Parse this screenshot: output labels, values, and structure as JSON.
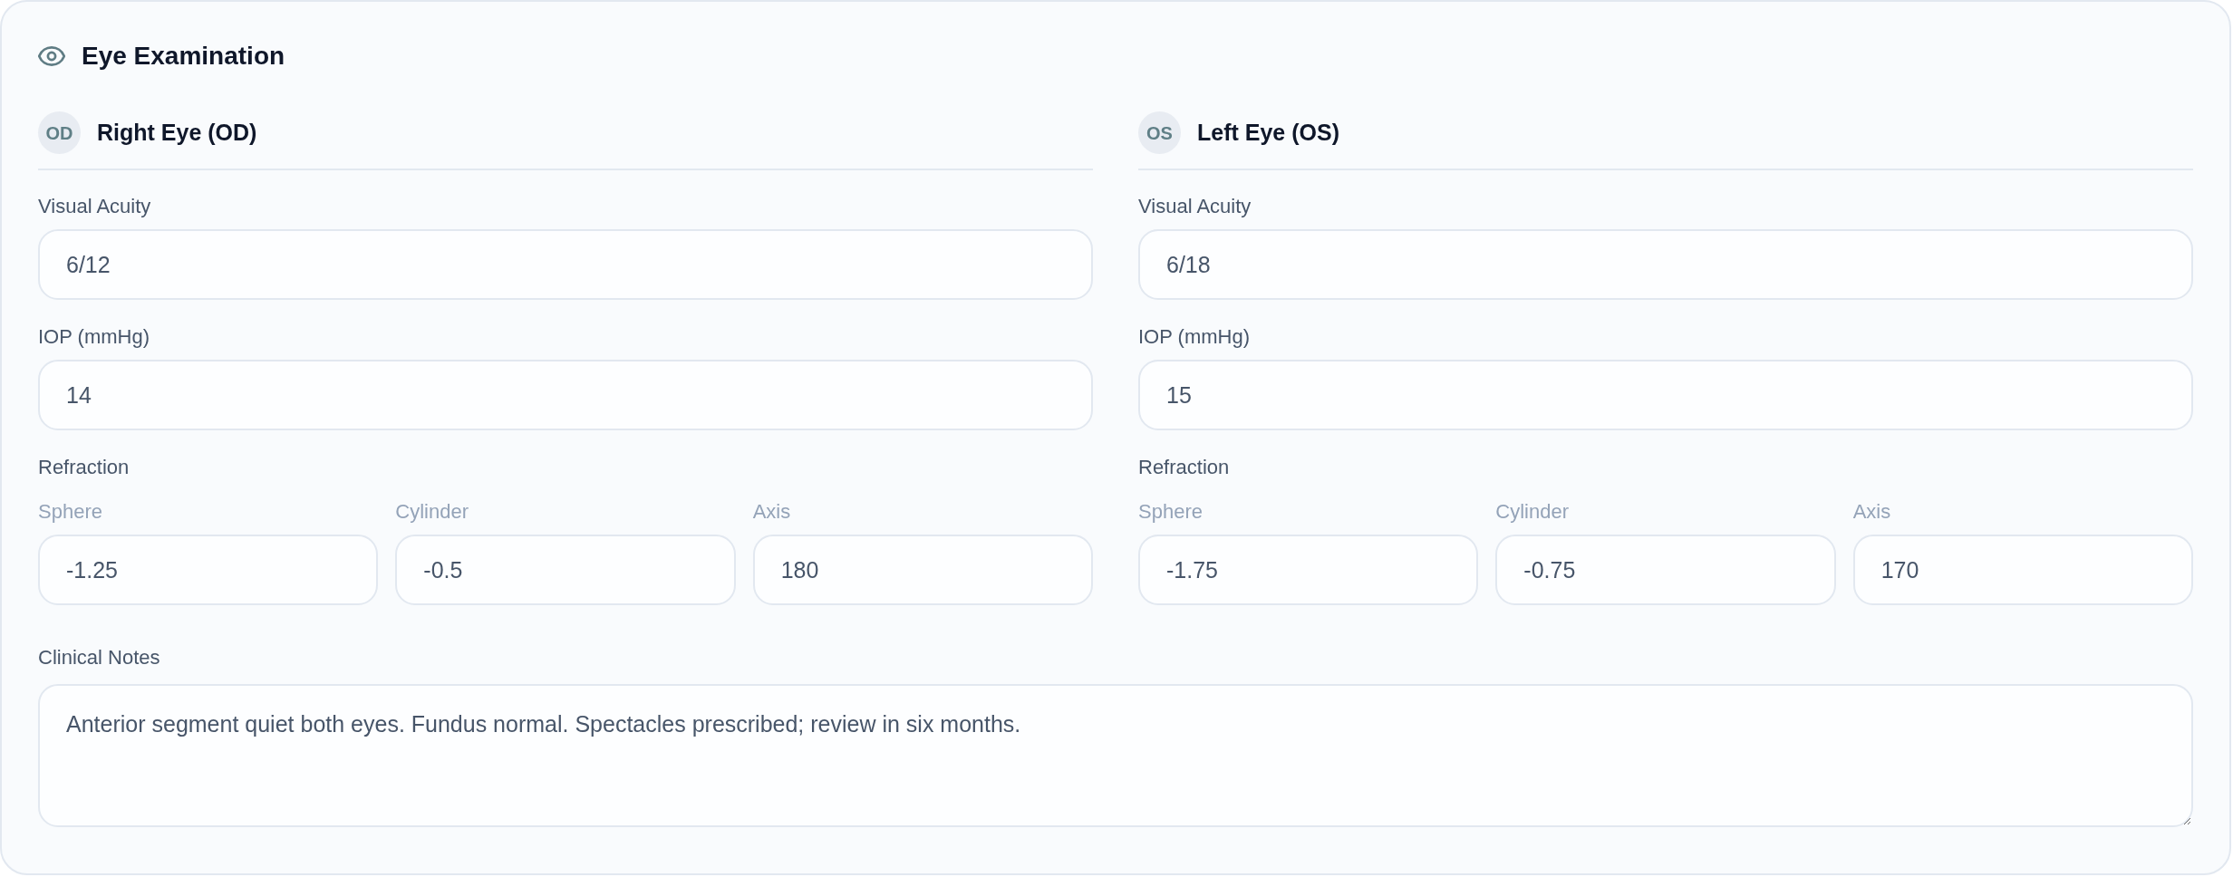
{
  "card": {
    "title": "Eye Examination"
  },
  "eyes": [
    {
      "badge": "OD",
      "title": "Right Eye (OD)",
      "fields": [
        {
          "label": "Visual Acuity",
          "value": "6/12"
        },
        {
          "label": "IOP (mmHg)",
          "value": "14"
        }
      ],
      "refraction": {
        "label": "Refraction",
        "fields": [
          {
            "label": "Sphere",
            "value": "-1.25"
          },
          {
            "label": "Cylinder",
            "value": "-0.5"
          },
          {
            "label": "Axis",
            "value": "180"
          }
        ]
      }
    },
    {
      "badge": "OS",
      "title": "Left Eye (OS)",
      "fields": [
        {
          "label": "Visual Acuity",
          "value": "6/18"
        },
        {
          "label": "IOP (mmHg)",
          "value": "15"
        }
      ],
      "refraction": {
        "label": "Refraction",
        "fields": [
          {
            "label": "Sphere",
            "value": "-1.75"
          },
          {
            "label": "Cylinder",
            "value": "-0.75"
          },
          {
            "label": "Axis",
            "value": "170"
          }
        ]
      }
    }
  ],
  "clinical_notes": {
    "label": "Clinical Notes",
    "value": "Anterior segment quiet both eyes. Fundus normal. Spectacles prescribed; review in six months."
  }
}
